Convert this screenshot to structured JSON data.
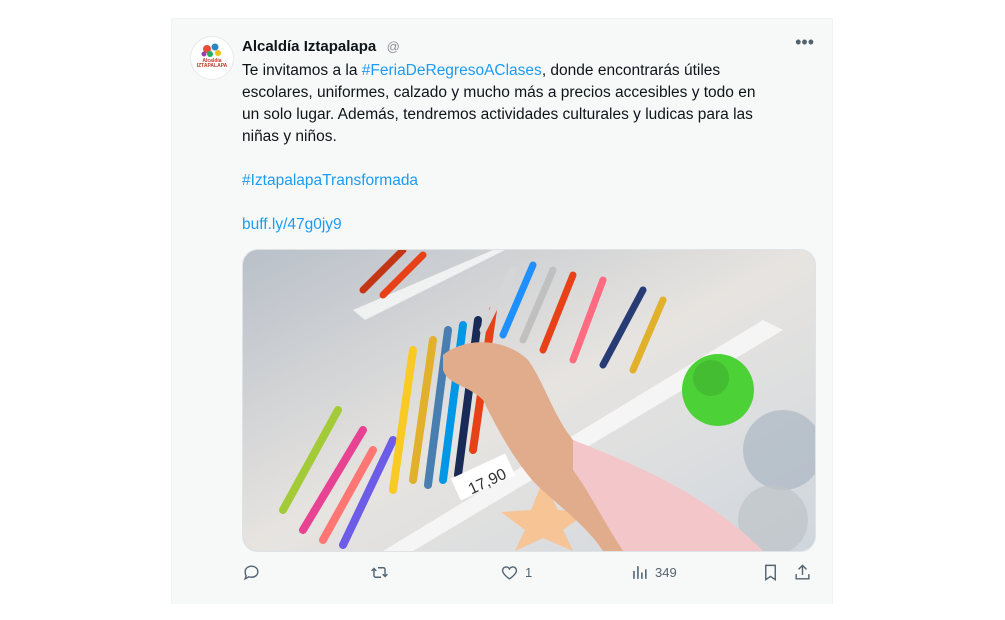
{
  "tweet": {
    "author_name": "Alcaldía Iztapalapa",
    "author_handle": "@ ",
    "avatar_label": "Alcaldía IZTAPALAPA",
    "text_before_hashtag": "Te invitamos a la ",
    "hashtag1": "#FeriaDeRegresoAClases",
    "text_after_hashtag_l1": ", donde encontrarás útiles",
    "text_l2": "escolares, uniformes, calzado y mucho más a precios accesibles y todo en",
    "text_l3": "un solo lugar. Además, tendremos actividades culturales y ludicas para las",
    "text_l4": "niñas y niños.",
    "hashtag2": "#IztapalapaTransformada",
    "link": "buff.ly/47g0jy9",
    "likes": "1",
    "views": "349"
  },
  "colors": {
    "accent": "#1d9bf0",
    "muted": "#536471"
  },
  "icons": [
    "more-icon",
    "reply-icon",
    "retweet-icon",
    "like-icon",
    "views-icon",
    "bookmark-icon",
    "share-icon"
  ]
}
